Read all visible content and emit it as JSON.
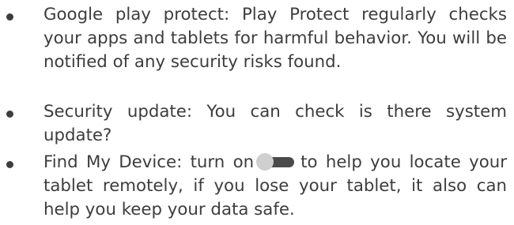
{
  "items": [
    {
      "text": "Google play protect: Play Protect regularly checks your apps and tablets for harmful behavior. You will be notified of any security risks found."
    },
    {
      "text": "Security update: You can check is there system update?"
    },
    {
      "text_before_toggle": "Find My Device: turn on",
      "toggle_state": "off",
      "toggle_icon": "toggle-switch-icon",
      "text_after_toggle": "to help you locate your tablet remotely, if you lose your tablet, it also can help you keep your data safe."
    }
  ],
  "colors": {
    "text": "#3d3d3d",
    "toggle_track": "#4a4a4a",
    "toggle_knob": "#cfcfcf"
  }
}
